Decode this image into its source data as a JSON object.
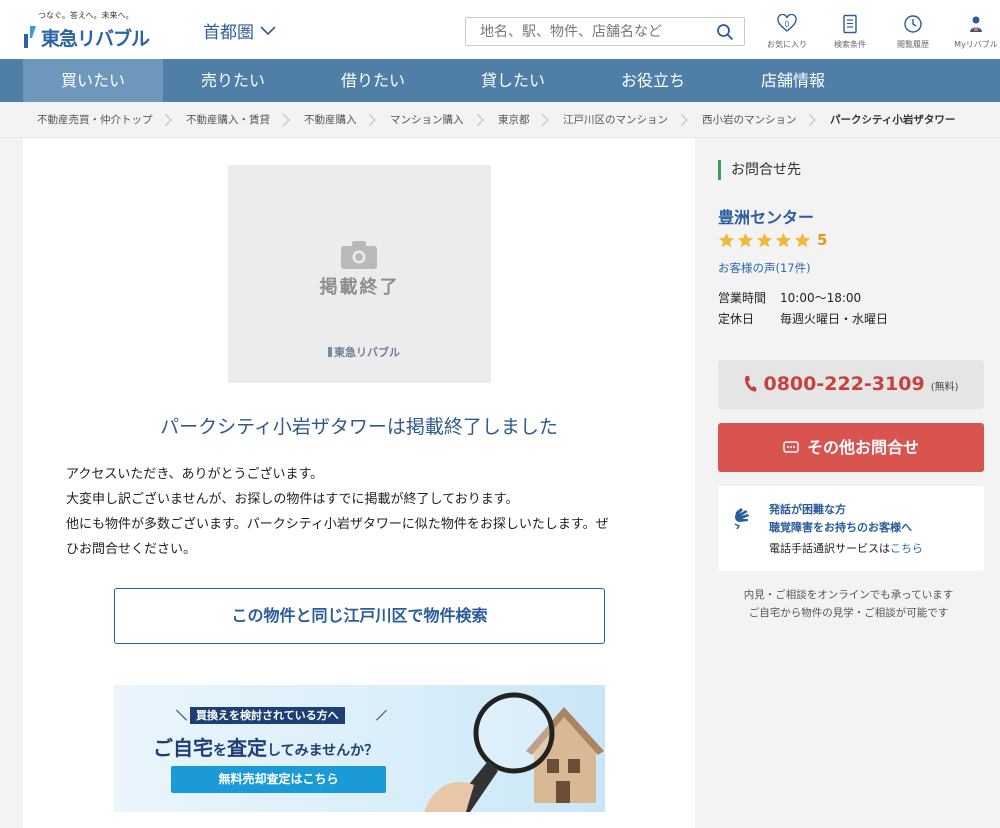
{
  "header": {
    "logo_tagline": "つなぐ。答えへ。未来へ。",
    "logo_text": "東急リバブル",
    "region": "首都圏",
    "search_placeholder": "地名、駅、物件、店舗名など",
    "icons": [
      {
        "label": "お気に入り",
        "badge": "0"
      },
      {
        "label": "検索条件"
      },
      {
        "label": "閲覧履歴"
      },
      {
        "label": "Myリバブル"
      }
    ]
  },
  "nav": {
    "items": [
      "買いたい",
      "売りたい",
      "借りたい",
      "貸したい",
      "お役立ち",
      "店舗情報"
    ],
    "active_index": 0
  },
  "breadcrumb": [
    "不動産売買・仲介トップ",
    "不動産購入・賃貸",
    "不動産購入",
    "マンション購入",
    "東京都",
    "江戸川区のマンション",
    "西小岩のマンション",
    "パークシティ小岩ザタワー"
  ],
  "main": {
    "placeholder_text": "掲載終了",
    "placeholder_logo": "東急リバブル",
    "title": "パークシティ小岩ザタワーは掲載終了しました",
    "message_lines": [
      "アクセスいただき、ありがとうございます。",
      "大変申し訳ございませんが、お探しの物件はすでに掲載が終了しております。",
      "他にも物件が多数ございます。パークシティ小岩ザタワーに似た物件をお探しいたします。ぜ",
      "ひお問合せください。"
    ],
    "search_button": "この物件と同じ江戸川区で物件検索",
    "banner": {
      "tagline": "買換えを検討されている方へ",
      "headline_a": "ご自宅",
      "headline_b": "を",
      "headline_c": "査定",
      "headline_d": "してみませんか？",
      "button": "無料売却査定はこちら"
    }
  },
  "sidebar": {
    "heading": "お問合せ先",
    "store": "豊洲センター",
    "rating": 5,
    "rating_text": "5",
    "reviews": "お客様の声(17件)",
    "hours_label": "営業時間",
    "hours_value": "10:00〜18:00",
    "closed_label": "定休日",
    "closed_value": "毎週火曜日・水曜日",
    "phone": "0800-222-3109",
    "phone_note": "(無料)",
    "other_contact": "その他お問合せ",
    "deaf_line1": "発話が困難な方",
    "deaf_line2": "聴覚障害をお持ちのお客様へ",
    "deaf_line3": "電話手話通訳サービスは",
    "deaf_link": "こちら",
    "online_line1": "内見・ご相談をオンラインでも承っています",
    "online_line2": "ご自宅から物件の見学・ご相談が可能です"
  },
  "colors": {
    "brand_blue": "#2a5d9a",
    "nav_bg": "#4f7fa6",
    "nav_active": "#6d98bb",
    "alert_red": "#d9534f",
    "star_gold": "#f2b739"
  }
}
